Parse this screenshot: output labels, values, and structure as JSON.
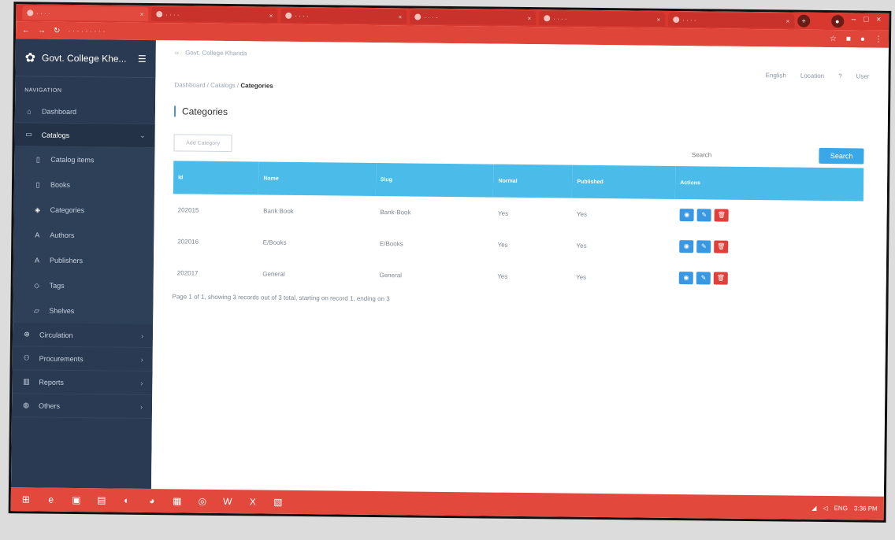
{
  "browser": {
    "tabs": [
      {
        "label": "· · · ·"
      },
      {
        "label": "· · · ·"
      },
      {
        "label": "· · · ·"
      },
      {
        "label": "· · · ·"
      },
      {
        "label": "· · · ·"
      },
      {
        "label": "· · · ·"
      }
    ]
  },
  "sidebar": {
    "brand_name": "Govt. College Khe...",
    "nav_head": "NAVIGATION",
    "items": [
      {
        "label": "Dashboard",
        "icon": "home-icon"
      },
      {
        "label": "Catalogs",
        "icon": "folder-icon"
      }
    ],
    "catalog_sub": [
      {
        "label": "Catalog items",
        "icon": "file-icon"
      },
      {
        "label": "Books",
        "icon": "file-icon"
      },
      {
        "label": "Categories",
        "icon": "tags-icon"
      },
      {
        "label": "Authors",
        "icon": "user-icon"
      },
      {
        "label": "Publishers",
        "icon": "user-icon"
      },
      {
        "label": "Tags",
        "icon": "tag-icon"
      },
      {
        "label": "Shelves",
        "icon": "shelf-icon"
      }
    ],
    "bottom": [
      {
        "label": "Circulation",
        "icon": "lock-icon"
      },
      {
        "label": "Procurements",
        "icon": "users-icon"
      },
      {
        "label": "Reports",
        "icon": "chart-icon"
      },
      {
        "label": "Others",
        "icon": "globe-icon"
      }
    ]
  },
  "main": {
    "topnav": "Govt. College Khanda",
    "topright": [
      "English",
      "Location",
      "?",
      "User"
    ],
    "breadcrumb": {
      "prefix": "Dashboard / Catalogs /",
      "current": "Categories"
    },
    "title": "Categories",
    "search_placeholder": "Search",
    "search_btn": "Search",
    "add_btn": "Add Category",
    "columns": [
      "Id",
      "Name",
      "Slug",
      "Normal",
      "Published",
      "Actions"
    ],
    "rows": [
      {
        "id": "202015",
        "name": "Bank Book",
        "slug": "Bank-Book",
        "normal": "Yes",
        "published": "Yes"
      },
      {
        "id": "202016",
        "name": "E/Books",
        "slug": "E/Books",
        "normal": "Yes",
        "published": "Yes"
      },
      {
        "id": "202017",
        "name": "General",
        "slug": "General",
        "normal": "Yes",
        "published": "Yes"
      }
    ],
    "pager": "Page 1 of 1, showing 3 records out of 3 total, starting on record 1, ending on 3"
  },
  "tray": {
    "lang": "ENG",
    "time": "3:36 PM"
  }
}
